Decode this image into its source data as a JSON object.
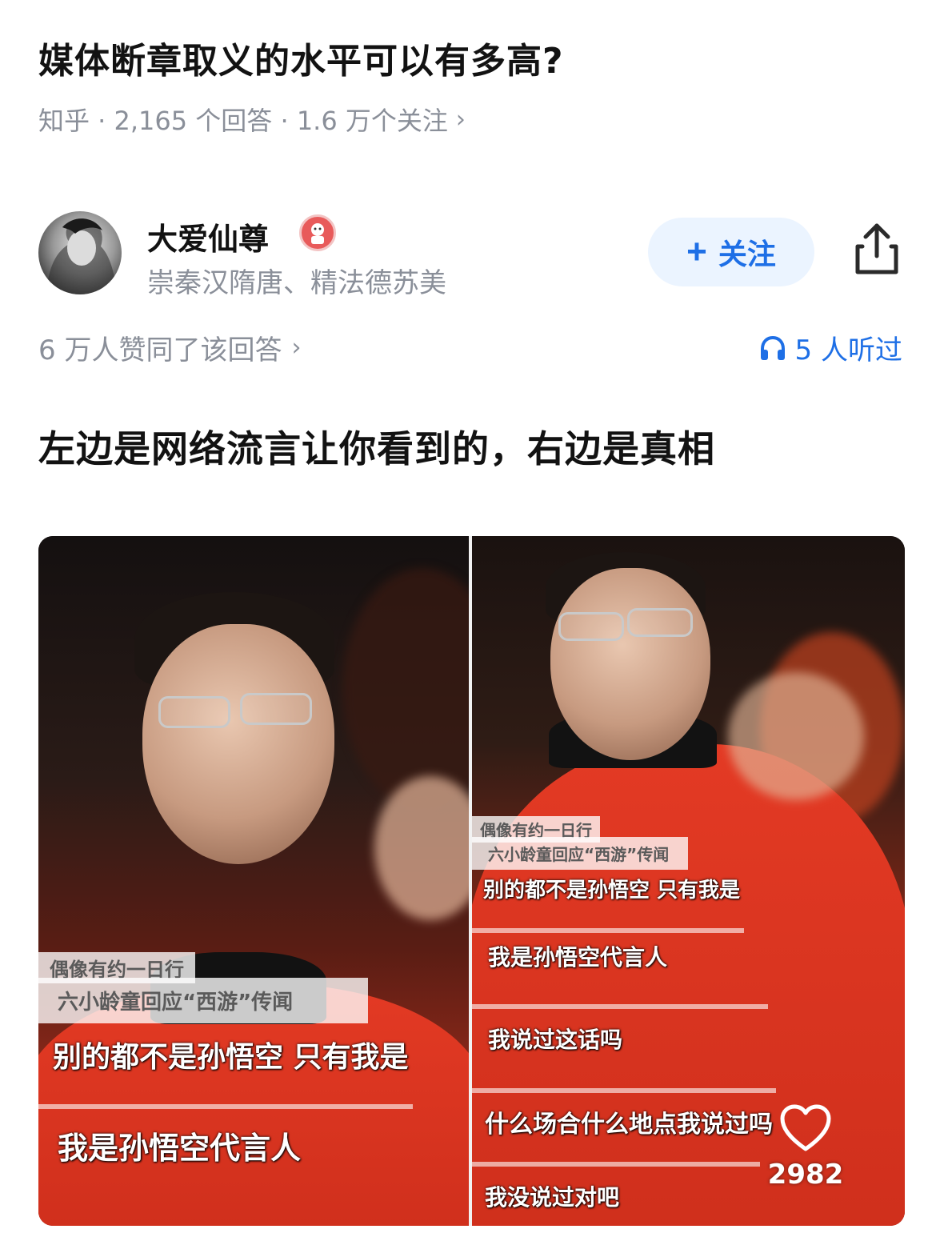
{
  "question": {
    "title": "媒体断章取义的水平可以有多高?",
    "meta": "知乎 · 2,165 个回答 · 1.6 万个关注",
    "chevron": "›"
  },
  "author": {
    "name": "大爱仙尊",
    "bio": "崇秦汉隋唐、精法德苏美",
    "follow_label": "关注",
    "follow_icon": "plus-icon"
  },
  "stats": {
    "votes": "6 万人赞同了该回答",
    "chevron": "›",
    "listen": "5 人听过"
  },
  "answer": {
    "text": "左边是网络流言让你看到的，右边是真相"
  },
  "media": {
    "left": {
      "show_title": "偶像有约一日行",
      "topic": "六小龄童回应“西游”传闻",
      "captions": [
        "别的都不是孙悟空 只有我是",
        "我是孙悟空代言人"
      ]
    },
    "right": {
      "show_title": "偶像有约一日行",
      "topic": "六小龄童回应“西游”传闻",
      "captions": [
        "别的都不是孙悟空 只有我是",
        "我是孙悟空代言人",
        "我说过这话吗",
        "什么场合什么地点我说过吗",
        "我没说过对吧"
      ]
    },
    "likes": "2982"
  },
  "colors": {
    "accent": "#1e6fe6",
    "muted": "#8a8f99",
    "follow_bg": "#ebf4ff",
    "shirt_red": "#e33a24"
  }
}
